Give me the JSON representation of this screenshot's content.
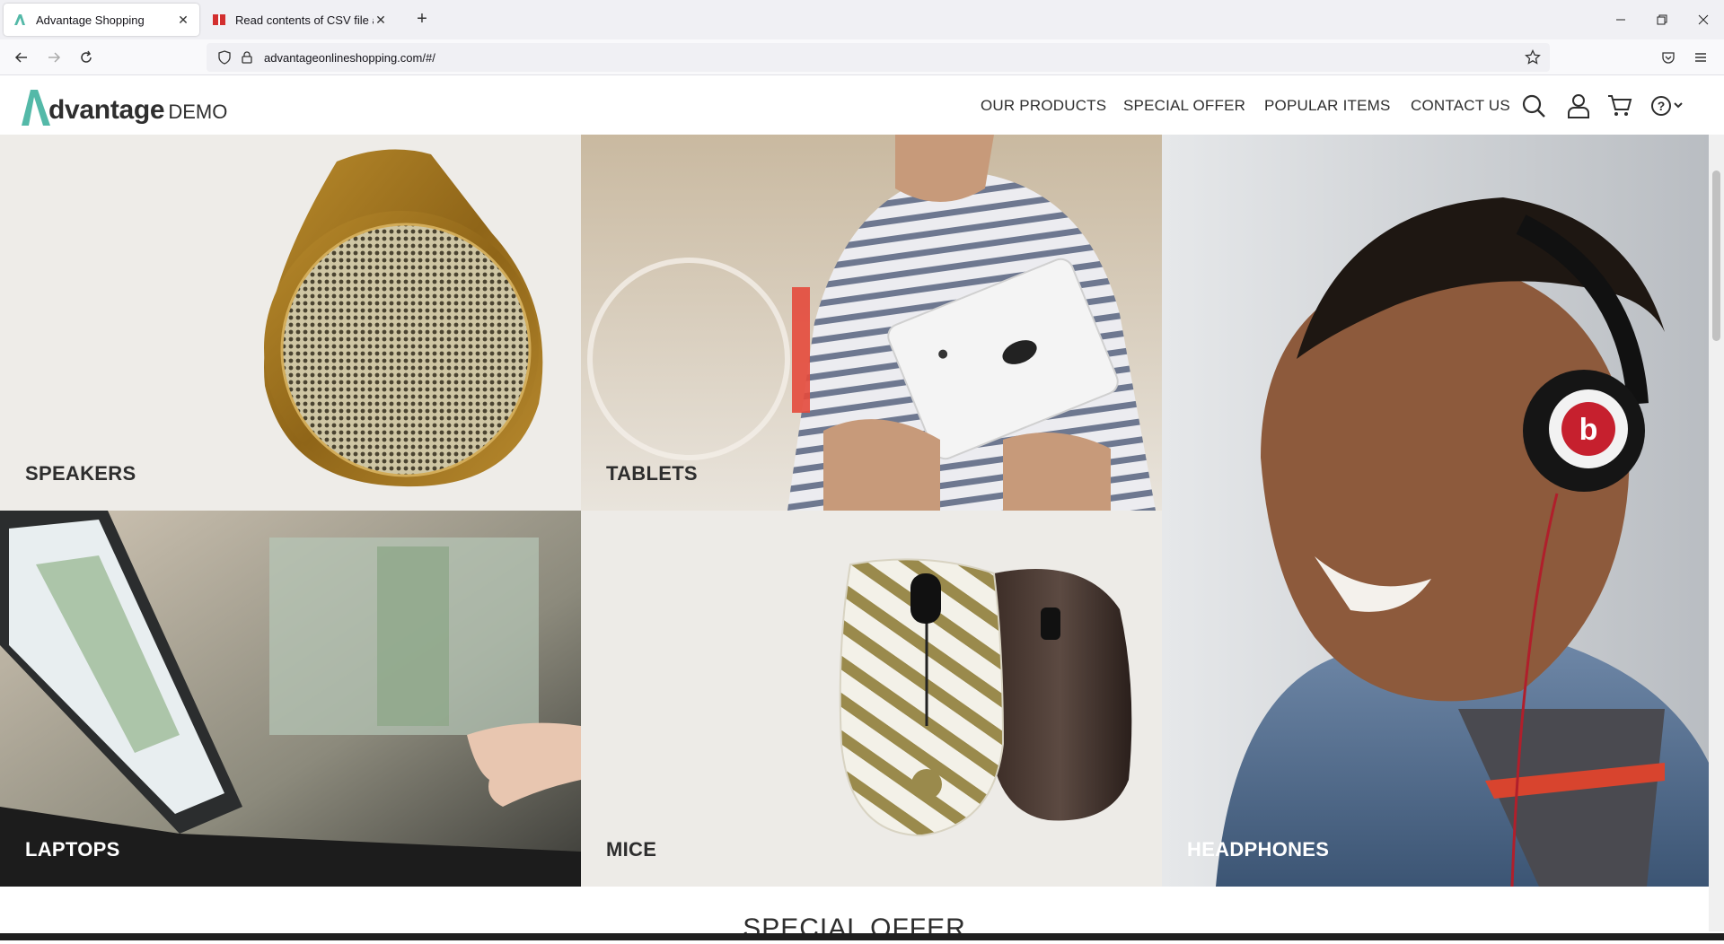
{
  "browser": {
    "tabs": [
      {
        "title": "Advantage Shopping",
        "active": true
      },
      {
        "title": "Read contents of CSV file and u",
        "active": false
      }
    ],
    "new_tab": "+",
    "url": "advantageonlineshopping.com/#/"
  },
  "site": {
    "logo_word": "dvantage",
    "logo_demo": "DEMO",
    "menu": [
      "OUR PRODUCTS",
      "SPECIAL OFFER",
      "POPULAR ITEMS",
      "CONTACT US"
    ],
    "icons": [
      "search-icon",
      "user-icon",
      "cart-icon",
      "help-icon"
    ]
  },
  "categories": [
    {
      "label": "SPEAKERS"
    },
    {
      "label": "TABLETS"
    },
    {
      "label": "HEADPHONES"
    },
    {
      "label": "LAPTOPS"
    },
    {
      "label": "MICE"
    }
  ],
  "section_title": "SPECIAL OFFER",
  "colors": {
    "brand_teal": "#54b9a8",
    "text_dark": "#2e2e2e"
  }
}
